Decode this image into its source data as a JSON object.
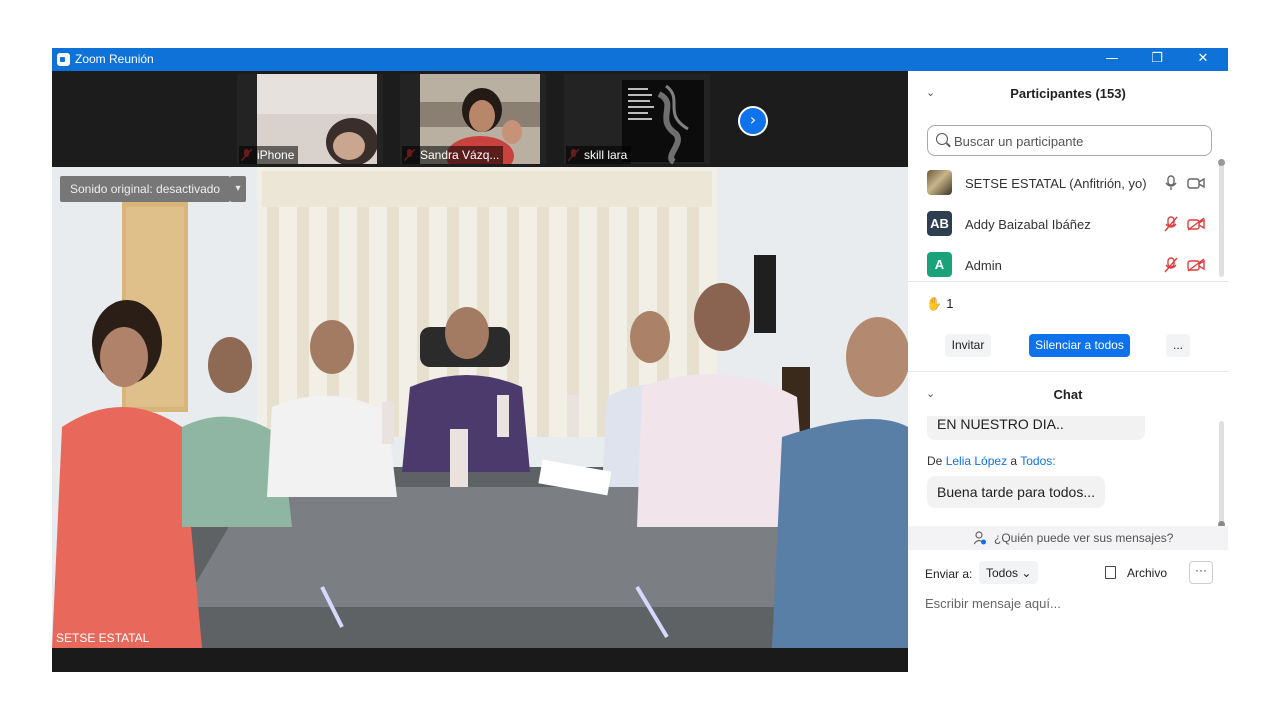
{
  "window": {
    "title": "Zoom Reunión"
  },
  "thumbnails": [
    {
      "name": "iPhone"
    },
    {
      "name": "Sandra Vázq..."
    },
    {
      "name": "skill lara"
    }
  ],
  "main_video": {
    "sound_toggle": "Sonido original: desactivado",
    "speaker_name": "SETSE ESTATAL"
  },
  "participants": {
    "title": "Participantes (153)",
    "search_placeholder": "Buscar un participante",
    "list": [
      {
        "name": "SETSE ESTATAL (Anfitrión, yo)",
        "initials": "",
        "avatar_color": "",
        "muted": false,
        "video_off": false
      },
      {
        "name": "Addy Baizabal Ibáñez",
        "initials": "AB",
        "avatar_color": "#2c3e50",
        "muted": true,
        "video_off": true
      },
      {
        "name": "Admin",
        "initials": "A",
        "avatar_color": "#1aa37a",
        "muted": true,
        "video_off": true
      }
    ],
    "reactions": {
      "icon": "clapping-hands-icon",
      "count": "1"
    },
    "buttons": {
      "invite": "Invitar",
      "mute_all": "Silenciar a todos",
      "more": "..."
    }
  },
  "chat": {
    "title": "Chat",
    "messages": [
      {
        "text": "EN NUESTRO DIA.."
      },
      {
        "from_prefix": "De",
        "sender": "Lelia López",
        "to_prefix": "a",
        "recipient": "Todos:",
        "text": "Buena tarde para todos..."
      }
    ],
    "visibility_note": "¿Quién puede ver sus mensajes?",
    "send_to_label": "Enviar a:",
    "send_to_value": "Todos",
    "file_label": "Archivo",
    "more_label": "···",
    "input_placeholder": "Escribir mensaje aquí..."
  },
  "colors": {
    "accent": "#0e72ed",
    "titlebar": "#0e72d8",
    "mic_off": "#e03e3e"
  }
}
